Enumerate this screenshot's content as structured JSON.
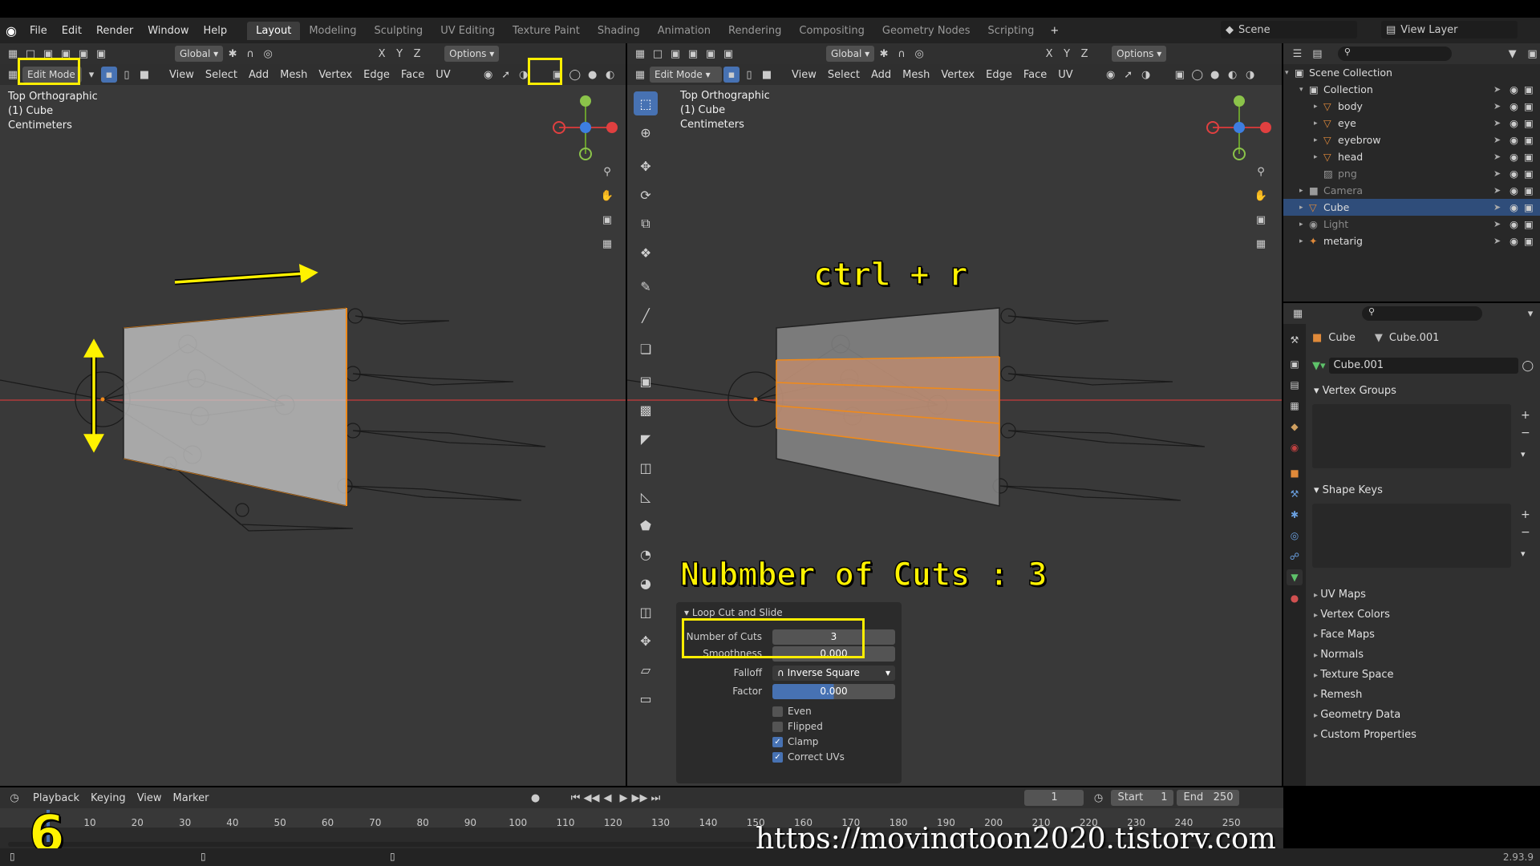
{
  "topbar": {
    "menus": [
      "File",
      "Edit",
      "Render",
      "Window",
      "Help"
    ],
    "workspaces": [
      "Layout",
      "Modeling",
      "Sculpting",
      "UV Editing",
      "Texture Paint",
      "Shading",
      "Animation",
      "Rendering",
      "Compositing",
      "Geometry Nodes",
      "Scripting"
    ],
    "add_tab": "+",
    "scene": "Scene",
    "view_layer": "View Layer"
  },
  "left_viewport": {
    "mode": "Edit Mode",
    "orientation": "Global",
    "options": "Options",
    "menus": [
      "View",
      "Select",
      "Add",
      "Mesh",
      "Vertex",
      "Edge",
      "Face",
      "UV"
    ],
    "axes": [
      "X",
      "Y",
      "Z"
    ],
    "info": [
      "Top Orthographic",
      "(1) Cube",
      "Centimeters"
    ]
  },
  "right_viewport": {
    "mode": "Edit Mode",
    "orientation": "Global",
    "options": "Options",
    "menus": [
      "View",
      "Select",
      "Add",
      "Mesh",
      "Vertex",
      "Edge",
      "Face",
      "UV"
    ],
    "axes": [
      "X",
      "Y",
      "Z"
    ],
    "info": [
      "Top Orthographic",
      "(1) Cube",
      "Centimeters"
    ]
  },
  "annotations": {
    "shortcut": "ctrl + r",
    "cuts_note": "Nubmber of Cuts : 3",
    "step_number": "6",
    "watermark": "https://movingtoon2020.tistory.com"
  },
  "operator": {
    "title": "Loop Cut and Slide",
    "fields": [
      {
        "label": "Number of Cuts",
        "value": "3"
      },
      {
        "label": "Smoothness",
        "value": "0.000"
      },
      {
        "label": "Falloff",
        "value": "Inverse Square"
      },
      {
        "label": "Factor",
        "value": "0.000"
      }
    ],
    "checkboxes": [
      {
        "label": "Even",
        "checked": false
      },
      {
        "label": "Flipped",
        "checked": false
      },
      {
        "label": "Clamp",
        "checked": true
      },
      {
        "label": "Correct UVs",
        "checked": true
      }
    ]
  },
  "outliner": {
    "rows": [
      {
        "name": "Scene Collection",
        "indent": 0,
        "icon": "collection-icon"
      },
      {
        "name": "Collection",
        "indent": 1,
        "icon": "collection-icon"
      },
      {
        "name": "body",
        "indent": 2,
        "icon": "mesh-icon"
      },
      {
        "name": "eye",
        "indent": 2,
        "icon": "mesh-icon"
      },
      {
        "name": "eyebrow",
        "indent": 2,
        "icon": "mesh-icon"
      },
      {
        "name": "head",
        "indent": 2,
        "icon": "mesh-icon"
      },
      {
        "name": "png",
        "indent": 2,
        "icon": "image-icon"
      },
      {
        "name": "Camera",
        "indent": 1,
        "icon": "camera-icon"
      },
      {
        "name": "Cube",
        "indent": 1,
        "icon": "mesh-icon"
      },
      {
        "name": "Light",
        "indent": 1,
        "icon": "light-icon"
      },
      {
        "name": "metarig",
        "indent": 1,
        "icon": "armature-icon"
      }
    ]
  },
  "properties": {
    "object": "Cube",
    "mesh": "Cube.001",
    "datablock": "Cube.001",
    "panels": [
      "Vertex Groups",
      "Shape Keys",
      "UV Maps",
      "Vertex Colors",
      "Face Maps",
      "Normals",
      "Texture Space",
      "Remesh",
      "Geometry Data",
      "Custom Properties"
    ]
  },
  "timeline": {
    "menus": [
      "Playback",
      "Keying",
      "View",
      "Marker"
    ],
    "current_frame": "1",
    "start_label": "Start",
    "start": "1",
    "end_label": "End",
    "end": "250",
    "ticks": [
      "10",
      "20",
      "30",
      "40",
      "50",
      "60",
      "70",
      "80",
      "90",
      "100",
      "110",
      "120",
      "130",
      "140",
      "150",
      "160",
      "170",
      "180",
      "190",
      "200",
      "210",
      "220",
      "230",
      "240",
      "250"
    ]
  },
  "status": {
    "version": "2.93.9"
  }
}
